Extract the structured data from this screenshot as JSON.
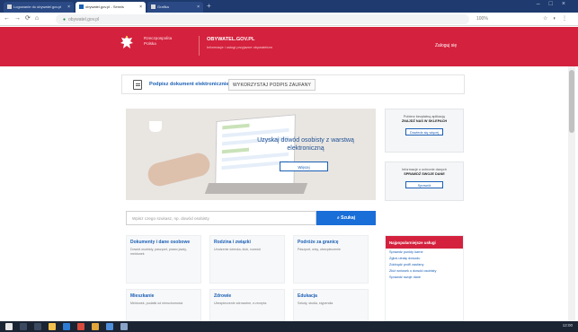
{
  "browser": {
    "tabs": [
      {
        "label": "Logowanie do obywatel.gov.pl"
      },
      {
        "label": "obywatel.gov.pl - Serwis"
      },
      {
        "label": "Grafika"
      }
    ],
    "new_tab": "+",
    "url": "obywatel.gov.pl",
    "zoom": "100%"
  },
  "header": {
    "gov_line1": "Rzeczpospolita",
    "gov_line2": "Polska",
    "site_name": "OBYWATEL.GOV.PL",
    "site_sub": "Informacje i usługi przyjazne obywatelom",
    "login": "Zaloguj się"
  },
  "breadcrumb": {
    "link": "Podpisz dokument elektronicznie",
    "current": "WYKORZYSTAJ PODPIS ZAUFANY"
  },
  "hero": {
    "title": "Uzyskaj dowód osobisty z warstwą elektroniczną",
    "button": "Więcej"
  },
  "promo_cards": [
    {
      "line1": "Pobierz bezpłatną aplikację",
      "line2": "ZNAJDŹ NAS W SKLEPACH",
      "button": "Dowiedz się więcej"
    },
    {
      "line1": "Informacje o ochronie danych",
      "line2": "SPRAWDŹ SWOJE DANE",
      "button": "Sprawdź"
    }
  ],
  "search": {
    "placeholder": "Wpisz czego szukasz, np. dowód osobisty",
    "button": "Szukaj"
  },
  "categories": [
    {
      "title": "Dokumenty i dane osobowe",
      "desc": "Dowód osobisty, paszport, prawo jazdy, meldunek"
    },
    {
      "title": "Rodzina i związki",
      "desc": "Urodzenie dziecka, ślub, rozwód"
    },
    {
      "title": "Podróże za granicę",
      "desc": "Paszport, wizy, ubezpieczenie"
    },
    {
      "title": "Mieszkanie",
      "desc": "Meldunek, podatki od nieruchomości"
    },
    {
      "title": "Zdrowie",
      "desc": "Ubezpieczenie zdrowotne, e-recepta"
    },
    {
      "title": "Edukacja",
      "desc": "Szkoły, studia, stypendia"
    }
  ],
  "popular": {
    "heading": "Najpopularniejsze usługi",
    "items": [
      "Sprawdź punkty karne",
      "Zgłoś utratę dowodu",
      "Zdobądź profil zaufany",
      "Złóż wniosek o dowód osobisty",
      "Sprawdź swoje dane"
    ]
  },
  "taskbar": {
    "tray": "12:00"
  },
  "colors": {
    "gov_red": "#d4213d",
    "link_blue": "#1a5fb4",
    "button_blue": "#1a6ed8",
    "chrome_blue": "#1e3a6e"
  }
}
